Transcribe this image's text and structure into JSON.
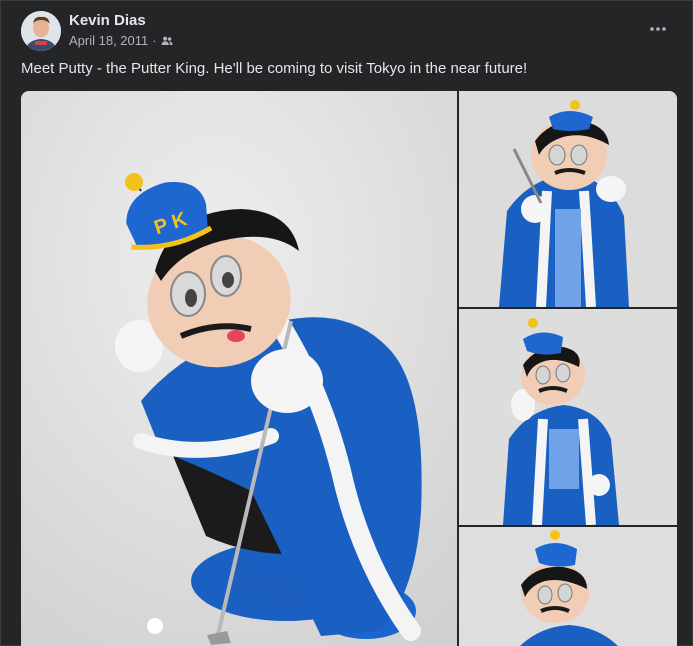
{
  "post": {
    "author": "Kevin Dias",
    "date": "April 18, 2011",
    "separator": "·",
    "audience_icon": "friends-icon",
    "more_icon": "more-options-icon",
    "text": "Meet Putty - the Putter King.  He'll be coming to visit Tokyo in the near future!"
  },
  "photos": [
    {
      "name": "Putty the Putter King crouching with putter"
    },
    {
      "name": "Putty the Putter King standing with putter"
    },
    {
      "name": "Putty the Putter King waving"
    },
    {
      "name": "Putty the Putter King close up"
    }
  ],
  "colors": {
    "background": "#242526",
    "text_primary": "#e4e6eb",
    "text_secondary": "#b0b3b8",
    "robe_blue": "#1a5fc2",
    "fur_white": "#f2f2f2",
    "crown_yellow": "#f2c21b",
    "backdrop": "#d9d9d9"
  }
}
